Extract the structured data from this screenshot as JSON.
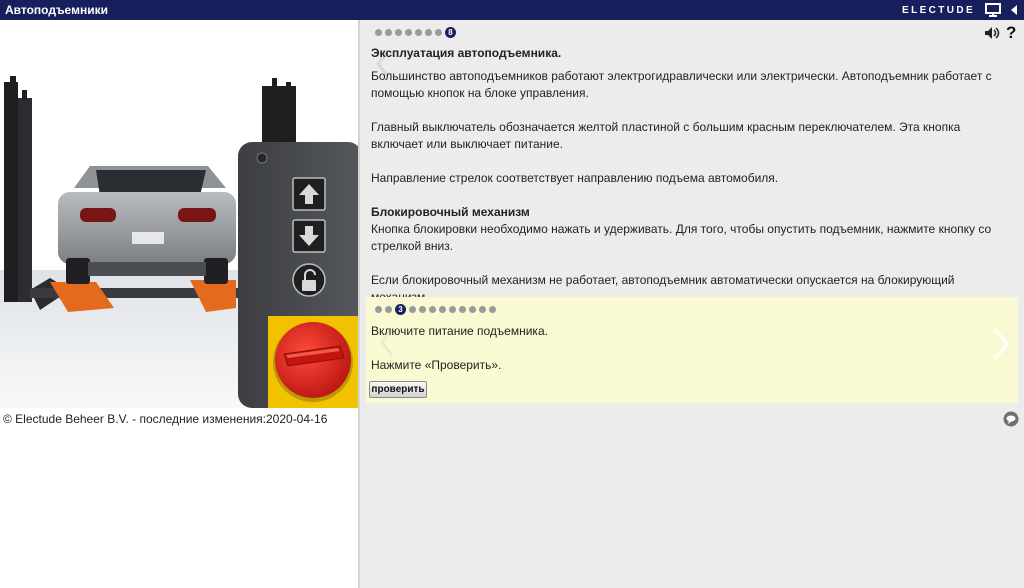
{
  "app": {
    "title": "Автоподъемники",
    "brand": "ELECTUDE"
  },
  "illustration": {
    "copyright": "© Electude Beheer B.V. - последние изменения:2020-04-16"
  },
  "info": {
    "page_badge": "8",
    "heading": "Эксплуатация автоподъемника.",
    "paragraphs": [
      "Большинство автоподъемников работают электрогидравлически или электрически. Автоподъемник работает с помощью кнопок на блоке управления.",
      "Главный выключатель обозначается желтой пластиной с большим красным переключателем. Эта кнопка включает или выключает питание.",
      "Направление стрелок соответствует направлению подъема автомобиля."
    ],
    "subheading": "Блокировочный механизм",
    "paragraphs2": [
      "Кнопка блокировки необходимо нажать и удерживать. Для того, чтобы опустить подъемник, нажмите кнопку со стрелкой вниз.",
      "Если блокировочный механизм не работает, автоподъемник автоматически опускается на блокирующий механизм."
    ]
  },
  "task": {
    "step_badge": "3",
    "instruction": "Включите питание подъемника.",
    "prompt": "Нажмите «Проверить».",
    "check_label": "проверить"
  },
  "help_label": "?",
  "colors": {
    "titlebar": "#17205c",
    "task_bg": "#fafad2",
    "switch_red": "#d81f1f",
    "switch_plate": "#f2c200"
  }
}
